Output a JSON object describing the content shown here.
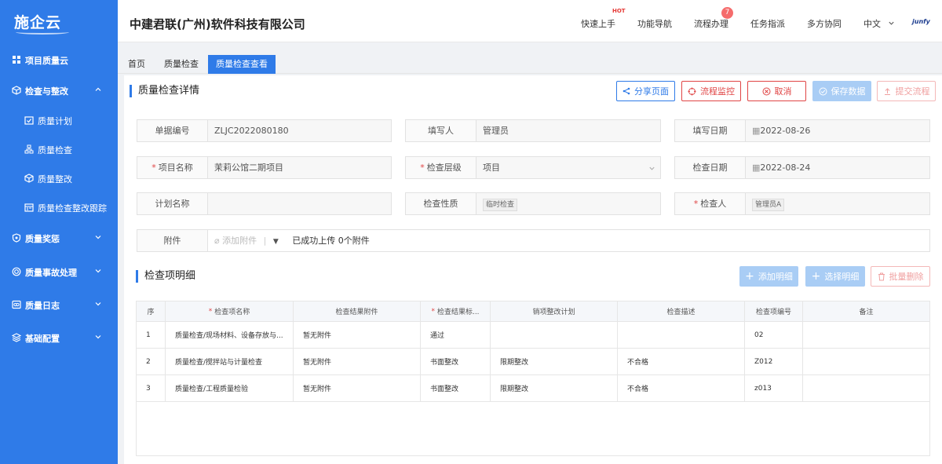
{
  "app": {
    "logo": "施企云",
    "company": "中建君联(广州)软件科技有限公司",
    "brand": "junfy"
  },
  "sidebar": {
    "items": [
      {
        "label": "项目质量云"
      },
      {
        "label": "检查与整改"
      },
      {
        "label": "质量计划"
      },
      {
        "label": "质量检查"
      },
      {
        "label": "质量整改"
      },
      {
        "label": "质量检查整改跟踪"
      },
      {
        "label": "质量奖惩"
      },
      {
        "label": "质量事故处理"
      },
      {
        "label": "质量日志"
      },
      {
        "label": "基础配置"
      }
    ]
  },
  "topmenu": {
    "quickstart": "快速上手",
    "hot": "HOT",
    "nav": "功能导航",
    "process": "流程办理",
    "process_badge": "7",
    "tasks": "任务指派",
    "collab": "多方协同",
    "lang": "中文"
  },
  "tabs": [
    "首页",
    "质量检查",
    "质量检查查看"
  ],
  "detail": {
    "title": "质量检查详情",
    "buttons": {
      "share": "分享页面",
      "monitor": "流程监控",
      "cancel": "取消",
      "save": "保存数据",
      "submit": "提交流程"
    }
  },
  "form": {
    "doc_no": {
      "label": "单据编号",
      "value": "ZLJC2022080180"
    },
    "writer": {
      "label": "填写人",
      "value": "管理员"
    },
    "write_date": {
      "label": "填写日期",
      "value": "2022-08-26"
    },
    "project": {
      "label": "项目名称",
      "value": "茉莉公馆二期项目"
    },
    "level": {
      "label": "检查层级",
      "value": "项目"
    },
    "check_date": {
      "label": "检查日期",
      "value": "2022-08-24"
    },
    "plan": {
      "label": "计划名称",
      "value": ""
    },
    "nature": {
      "label": "检查性质",
      "value": "临时检查"
    },
    "inspector": {
      "label": "检查人",
      "value": "管理员A"
    },
    "attachment": {
      "label": "附件",
      "add": "添加附件",
      "status": "已成功上传 0个附件"
    }
  },
  "items": {
    "title": "检查项明细",
    "buttons": {
      "add": "添加明细",
      "select": "选择明细",
      "batch_delete": "批量删除"
    },
    "columns": [
      "序",
      "检查项名称",
      "检查结果附件",
      "检查结果标...",
      "销项整改计划",
      "检查描述",
      "检查项编号",
      "备注"
    ],
    "rows": [
      [
        "1",
        "质量检查/现场材料、设备存放与...",
        "暂无附件",
        "通过",
        "",
        "",
        "02",
        ""
      ],
      [
        "2",
        "质量检查/搅拌站与计量检查",
        "暂无附件",
        "书面整改",
        "限期整改",
        "不合格",
        "Z012",
        ""
      ],
      [
        "3",
        "质量检查/工程质量检验",
        "暂无附件",
        "书面整改",
        "限期整改",
        "不合格",
        "z013",
        ""
      ]
    ]
  }
}
